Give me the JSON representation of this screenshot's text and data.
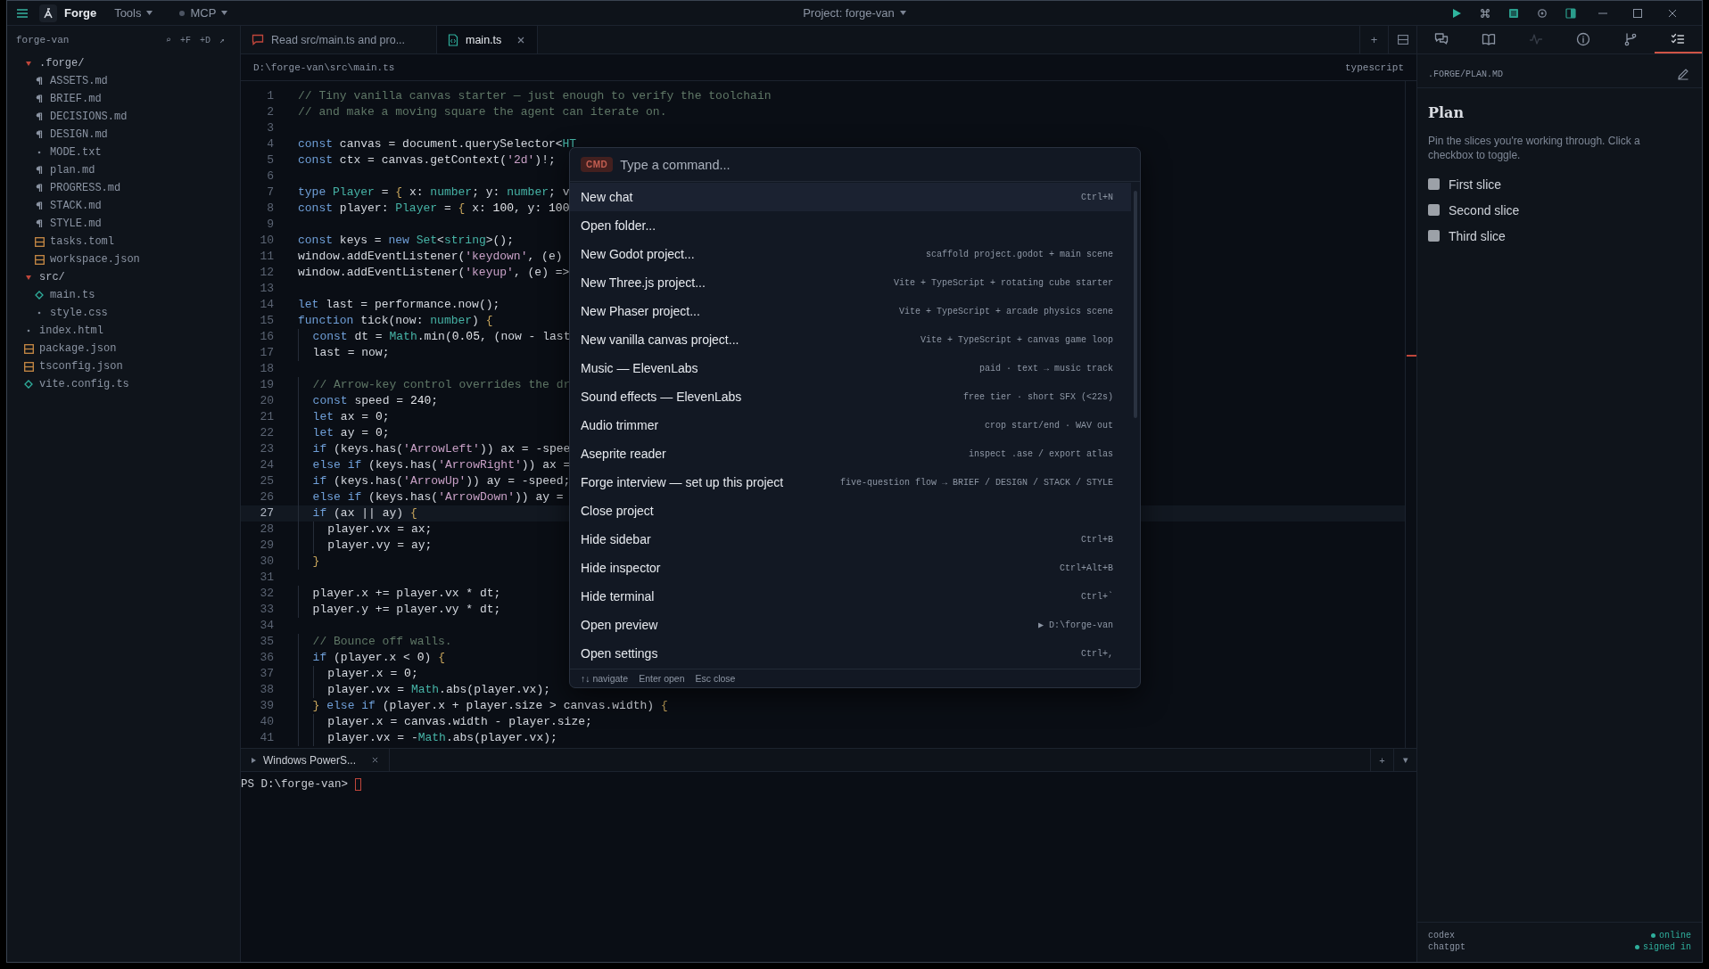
{
  "titlebar": {
    "app_name": "Forge",
    "menus": [
      {
        "label": "Tools",
        "kind": "plain"
      },
      {
        "label": "MCP",
        "kind": "status"
      }
    ],
    "project": "Project: forge-van"
  },
  "sidebar": {
    "title": "forge-van",
    "actions": [
      "⌕",
      "+F",
      "+D",
      "↗"
    ],
    "tree": [
      {
        "name": ".forge/",
        "kind": "folder",
        "expanded": true,
        "children": [
          {
            "name": "ASSETS.md",
            "kind": "markdown"
          },
          {
            "name": "BRIEF.md",
            "kind": "markdown"
          },
          {
            "name": "DECISIONS.md",
            "kind": "markdown"
          },
          {
            "name": "DESIGN.md",
            "kind": "markdown"
          },
          {
            "name": "MODE.txt",
            "kind": "text"
          },
          {
            "name": "plan.md",
            "kind": "markdown"
          },
          {
            "name": "PROGRESS.md",
            "kind": "markdown"
          },
          {
            "name": "STACK.md",
            "kind": "markdown"
          },
          {
            "name": "STYLE.md",
            "kind": "markdown"
          },
          {
            "name": "tasks.toml",
            "kind": "config"
          },
          {
            "name": "workspace.json",
            "kind": "config"
          }
        ]
      },
      {
        "name": "src/",
        "kind": "folder",
        "expanded": true,
        "children": [
          {
            "name": "main.ts",
            "kind": "script"
          },
          {
            "name": "style.css",
            "kind": "text"
          }
        ]
      },
      {
        "name": "index.html",
        "kind": "text"
      },
      {
        "name": "package.json",
        "kind": "config"
      },
      {
        "name": "tsconfig.json",
        "kind": "config"
      },
      {
        "name": "vite.config.ts",
        "kind": "script"
      }
    ]
  },
  "editor": {
    "tabs": [
      {
        "label": "Read src/main.ts and pro...",
        "kind": "chat",
        "selected": false,
        "closable": false
      },
      {
        "label": "main.ts",
        "kind": "file",
        "selected": true,
        "closable": true
      }
    ],
    "tab_actions": [
      "+"
    ],
    "path": "D:\\forge-van\\src\\main.ts",
    "language": "typescript",
    "lines": [
      {
        "number": "1",
        "text": "// Tiny vanilla canvas starter — just enough to verify the toolchain",
        "current": false
      },
      {
        "number": "2",
        "text": "// and make a moving square the agent can iterate on.",
        "current": false
      },
      {
        "number": "3",
        "current": false
      },
      {
        "number": "4",
        "text": "const canvas = document.querySelector<HT",
        "current": false
      },
      {
        "number": "5",
        "text": "const ctx = canvas.getContext('2d')!;",
        "current": false
      },
      {
        "number": "6",
        "current": false
      },
      {
        "number": "7",
        "text": "type Player = { x: number; y: number; v",
        "current": false
      },
      {
        "number": "8",
        "text": "const player: Player = { x: 100, y: 100",
        "current": false
      },
      {
        "number": "9",
        "current": false
      },
      {
        "number": "10",
        "text": "const keys = new Set<string>();",
        "current": false
      },
      {
        "number": "11",
        "text": "window.addEventListener('keydown', (e)",
        "current": false
      },
      {
        "number": "12",
        "text": "window.addEventListener('keyup', (e) =>",
        "current": false
      },
      {
        "number": "13",
        "current": false
      },
      {
        "number": "14",
        "text": "let last = performance.now();",
        "current": false
      },
      {
        "number": "15",
        "text": "function tick(now: number) {",
        "current": false
      },
      {
        "number": "16",
        "text": "  const dt = Math.min(0.05, (now - last",
        "current": false
      },
      {
        "number": "17",
        "text": "  last = now;",
        "current": false
      },
      {
        "number": "18",
        "current": false
      },
      {
        "number": "19",
        "text": "  // Arrow-key control overrides the dr",
        "current": false
      },
      {
        "number": "20",
        "text": "  const speed = 240;",
        "current": false
      },
      {
        "number": "21",
        "text": "  let ax = 0;",
        "current": false
      },
      {
        "number": "22",
        "text": "  let ay = 0;",
        "current": false
      },
      {
        "number": "23",
        "text": "  if (keys.has('ArrowLeft')) ax = -spee",
        "current": false
      },
      {
        "number": "24",
        "text": "  else if (keys.has('ArrowRight')) ax =",
        "current": false
      },
      {
        "number": "25",
        "text": "  if (keys.has('ArrowUp')) ay = -speed;",
        "current": false
      },
      {
        "number": "26",
        "text": "  else if (keys.has('ArrowDown')) ay =",
        "current": false
      },
      {
        "number": "27",
        "text": "  if (ax || ay) {",
        "current": true
      },
      {
        "number": "28",
        "text": "    player.vx = ax;",
        "current": false
      },
      {
        "number": "29",
        "text": "    player.vy = ay;",
        "current": false
      },
      {
        "number": "30",
        "text": "  }",
        "current": false
      },
      {
        "number": "31",
        "current": false
      },
      {
        "number": "32",
        "text": "  player.x += player.vx * dt;",
        "current": false
      },
      {
        "number": "33",
        "text": "  player.y += player.vy * dt;",
        "current": false
      },
      {
        "number": "34",
        "current": false
      },
      {
        "number": "35",
        "text": "  // Bounce off walls.",
        "current": false
      },
      {
        "number": "36",
        "text": "  if (player.x < 0) {",
        "current": false
      },
      {
        "number": "37",
        "text": "    player.x = 0;",
        "current": false
      },
      {
        "number": "38",
        "text": "    player.vx = Math.abs(player.vx);",
        "current": false
      },
      {
        "number": "39",
        "text": "  } else if (player.x + player.size > canvas.width) {",
        "current": false
      },
      {
        "number": "40",
        "text": "    player.x = canvas.width - player.size;",
        "current": false
      },
      {
        "number": "41",
        "text": "    player.vx = -Math.abs(player.vx);",
        "current": false
      }
    ]
  },
  "terminal": {
    "tabs": [
      {
        "label": "Windows PowerS...",
        "selected": true
      }
    ],
    "actions": [
      "+",
      "▾"
    ],
    "prompt": "PS D:\\forge-van>"
  },
  "palette": {
    "badge": "CMD",
    "placeholder": "Type a command...",
    "items": [
      {
        "label": "New chat",
        "hint": "Ctrl+N",
        "selected": true
      },
      {
        "label": "Open folder...",
        "selected": false
      },
      {
        "label": "New Godot project...",
        "hint": "scaffold project.godot + main scene",
        "selected": false
      },
      {
        "label": "New Three.js project...",
        "hint": "Vite + TypeScript + rotating cube starter",
        "selected": false
      },
      {
        "label": "New Phaser project...",
        "hint": "Vite + TypeScript + arcade physics scene",
        "selected": false
      },
      {
        "label": "New vanilla canvas project...",
        "hint": "Vite + TypeScript + canvas game loop",
        "selected": false
      },
      {
        "label": "Music — ElevenLabs",
        "hint": "paid · text → music track",
        "selected": false
      },
      {
        "label": "Sound effects — ElevenLabs",
        "hint": "free tier · short SFX (<22s)",
        "selected": false
      },
      {
        "label": "Audio trimmer",
        "hint": "crop start/end · WAV out",
        "selected": false
      },
      {
        "label": "Aseprite reader",
        "hint": "inspect .ase / export atlas",
        "selected": false
      },
      {
        "label": "Forge interview — set up this project",
        "hint": "five-question flow → BRIEF / DESIGN / STACK / STYLE",
        "selected": false
      },
      {
        "label": "Close project",
        "selected": false
      },
      {
        "label": "Hide sidebar",
        "hint": "Ctrl+B",
        "selected": false
      },
      {
        "label": "Hide inspector",
        "hint": "Ctrl+Alt+B",
        "selected": false
      },
      {
        "label": "Hide terminal",
        "hint": "Ctrl+`",
        "selected": false
      },
      {
        "label": "Open preview",
        "hint": "▶ D:\\forge-van",
        "selected": false
      },
      {
        "label": "Open settings",
        "hint": "Ctrl+,",
        "selected": false
      }
    ],
    "footer": [
      "↑↓ navigate",
      "Enter open",
      "Esc close"
    ]
  },
  "inspector": {
    "tabs": [
      {
        "kind": "chat",
        "selected": false,
        "disabled": false
      },
      {
        "kind": "book",
        "selected": false,
        "disabled": false
      },
      {
        "kind": "activity",
        "selected": false,
        "disabled": true
      },
      {
        "kind": "info",
        "selected": false,
        "disabled": false
      },
      {
        "kind": "branch",
        "selected": false,
        "disabled": false
      },
      {
        "kind": "checklist",
        "selected": true,
        "disabled": false
      }
    ],
    "path": ".FORGE/PLAN.MD",
    "title": "Plan",
    "description": "Pin the slices you're working through. Click a checkbox to toggle.",
    "tasks": [
      {
        "label": "First slice",
        "checked": false
      },
      {
        "label": "Second slice",
        "checked": false
      },
      {
        "label": "Third slice",
        "checked": false
      }
    ],
    "status": [
      {
        "name": "codex",
        "state": "online"
      },
      {
        "name": "chatgpt",
        "state": "signed in"
      }
    ]
  }
}
